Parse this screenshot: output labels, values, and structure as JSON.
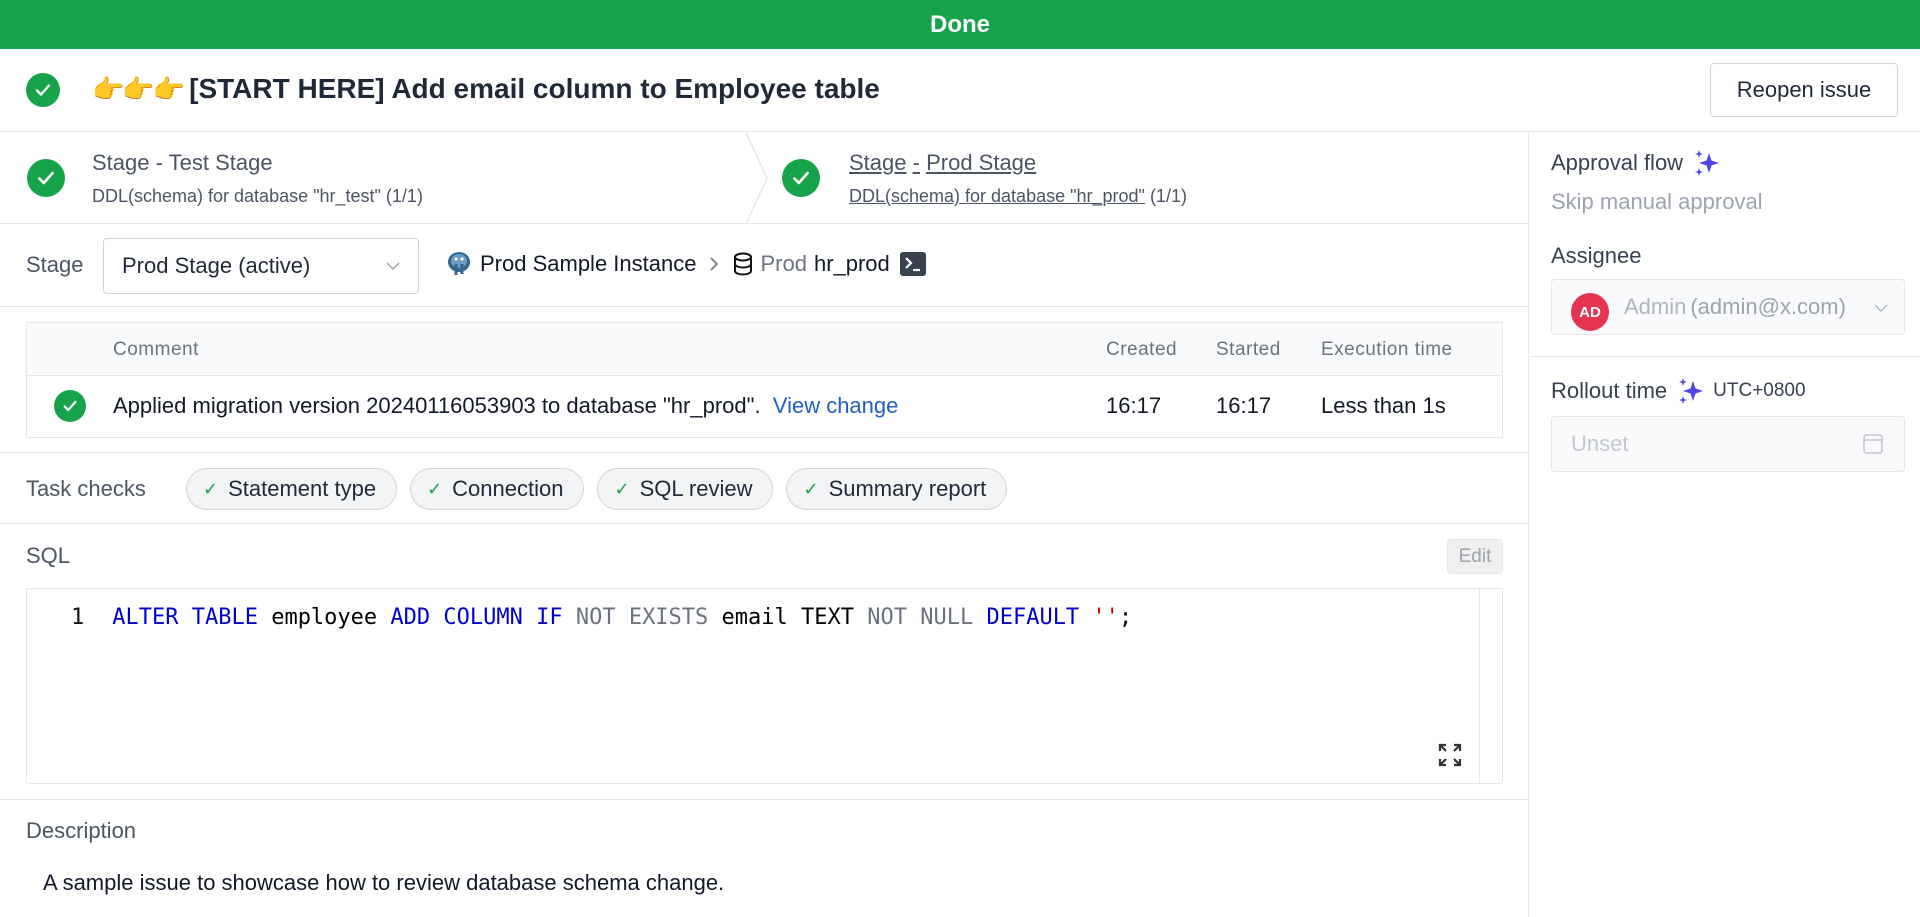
{
  "banner": {
    "status": "Done"
  },
  "header": {
    "title_emoji": "👉👉👉",
    "title": "[START HERE] Add email column to Employee table",
    "reopen_label": "Reopen issue"
  },
  "stages": [
    {
      "title_prefix": "Stage",
      "title_sep": "-",
      "title_name": "Test Stage",
      "subtitle": "DDL(schema) for database \"hr_test\"",
      "count": "(1/1)",
      "status": "done",
      "active": false
    },
    {
      "title_prefix": "Stage",
      "title_sep": "-",
      "title_name": "Prod Stage",
      "subtitle": "DDL(schema) for database \"hr_prod\"",
      "count": "(1/1)",
      "status": "done",
      "active": true
    }
  ],
  "stage_selector": {
    "label": "Stage",
    "selected": "Prod Stage (active)"
  },
  "breadcrumb": {
    "instance": "Prod Sample Instance",
    "environment": "Prod",
    "database": "hr_prod"
  },
  "task_table": {
    "columns": [
      "Comment",
      "Created",
      "Started",
      "Execution time"
    ],
    "rows": [
      {
        "status": "done",
        "comment": "Applied migration version 20240116053903 to database \"hr_prod\".",
        "link": "View change",
        "created": "16:17",
        "started": "16:17",
        "execution_time": "Less than 1s"
      }
    ]
  },
  "task_checks": {
    "label": "Task checks",
    "items": [
      "Statement type",
      "Connection",
      "SQL review",
      "Summary report"
    ]
  },
  "sql": {
    "label": "SQL",
    "edit_label": "Edit",
    "line_number": "1",
    "tokens": [
      {
        "t": "ALTER TABLE",
        "c": "kw"
      },
      {
        "t": " employee ",
        "c": ""
      },
      {
        "t": "ADD COLUMN IF",
        "c": "kw"
      },
      {
        "t": " NOT EXISTS",
        "c": "kw2"
      },
      {
        "t": " email TEXT ",
        "c": ""
      },
      {
        "t": "NOT NULL",
        "c": "kw2"
      },
      {
        "t": " DEFAULT",
        "c": "kw"
      },
      {
        "t": " ''",
        "c": "str"
      },
      {
        "t": ";",
        "c": ""
      }
    ]
  },
  "description": {
    "label": "Description",
    "text": "A sample issue to showcase how to review database schema change."
  },
  "sidebar": {
    "approval_flow": {
      "label": "Approval flow",
      "value": "Skip manual approval"
    },
    "assignee": {
      "label": "Assignee",
      "avatar_initials": "AD",
      "name": "Admin",
      "email": "(admin@x.com)"
    },
    "rollout_time": {
      "label": "Rollout time",
      "timezone": "UTC+0800",
      "placeholder": "Unset"
    }
  },
  "colors": {
    "success": "#16a34a",
    "accent": "#4f46e5",
    "link": "#1e60c0",
    "avatar": "#e5344f"
  }
}
